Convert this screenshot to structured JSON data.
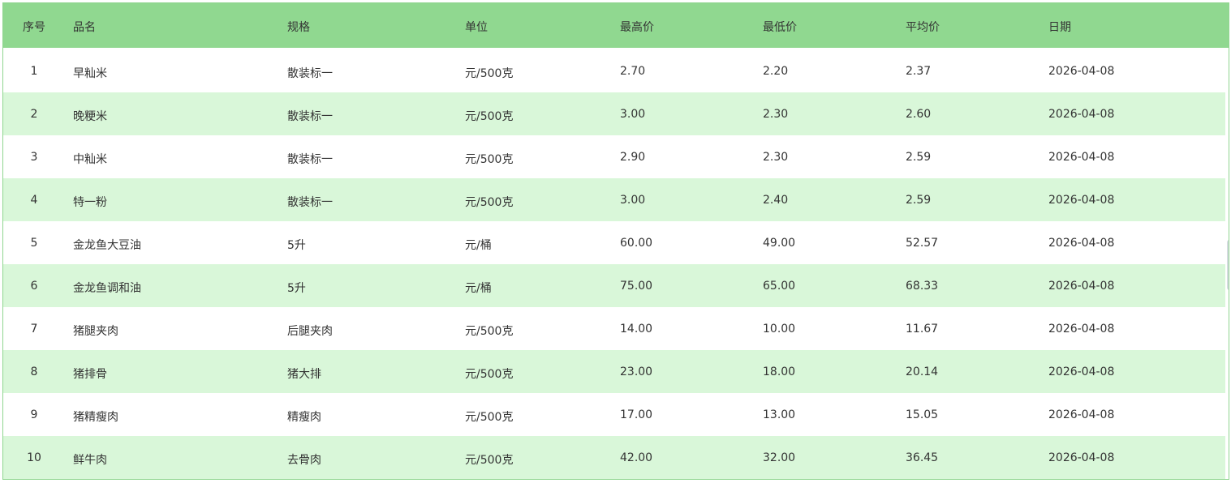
{
  "table": {
    "headers": [
      "序号",
      "品名",
      "规格",
      "单位",
      "最高价",
      "最低价",
      "平均价",
      "日期"
    ],
    "rows": [
      [
        "1",
        "早籼米",
        "散装标一",
        "元/500克",
        "2.70",
        "2.20",
        "2.37",
        "2026-04-08"
      ],
      [
        "2",
        "晚粳米",
        "散装标一",
        "元/500克",
        "3.00",
        "2.30",
        "2.60",
        "2026-04-08"
      ],
      [
        "3",
        "中籼米",
        "散装标一",
        "元/500克",
        "2.90",
        "2.30",
        "2.59",
        "2026-04-08"
      ],
      [
        "4",
        "特一粉",
        "散装标一",
        "元/500克",
        "3.00",
        "2.40",
        "2.59",
        "2026-04-08"
      ],
      [
        "5",
        "金龙鱼大豆油",
        "5升",
        "元/桶",
        "60.00",
        "49.00",
        "52.57",
        "2026-04-08"
      ],
      [
        "6",
        "金龙鱼调和油",
        "5升",
        "元/桶",
        "75.00",
        "65.00",
        "68.33",
        "2026-04-08"
      ],
      [
        "7",
        "猪腿夹肉",
        "后腿夹肉",
        "元/500克",
        "14.00",
        "10.00",
        "11.67",
        "2026-04-08"
      ],
      [
        "8",
        "猪排骨",
        "猪大排",
        "元/500克",
        "23.00",
        "18.00",
        "20.14",
        "2026-04-08"
      ],
      [
        "9",
        "猪精瘦肉",
        "精瘦肉",
        "元/500克",
        "17.00",
        "13.00",
        "15.05",
        "2026-04-08"
      ],
      [
        "10",
        "鲜牛肉",
        "去骨肉",
        "元/500克",
        "42.00",
        "32.00",
        "36.45",
        "2026-04-08"
      ]
    ]
  },
  "colors": {
    "header_bg": "#90d890",
    "alt_row_bg": "#d9f7d9",
    "border": "#8fd58f",
    "text": "#333333"
  }
}
